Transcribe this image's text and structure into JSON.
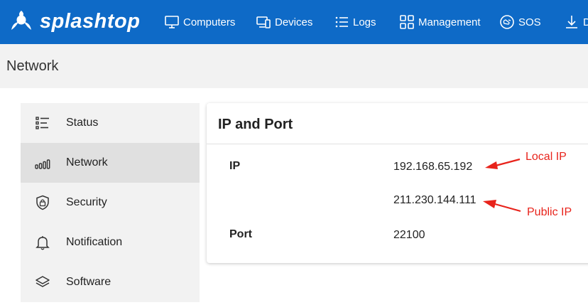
{
  "brand": {
    "logo_text": "splashtop"
  },
  "nav": {
    "items": [
      {
        "label": "Computers",
        "icon": "monitor-icon"
      },
      {
        "label": "Devices",
        "icon": "devices-icon"
      },
      {
        "label": "Logs",
        "icon": "list-icon"
      },
      {
        "label": "Management",
        "icon": "grid-icon"
      },
      {
        "label": "SOS",
        "icon": "sos-icon"
      },
      {
        "label": "D",
        "icon": "download-icon"
      }
    ]
  },
  "page": {
    "title": "Network"
  },
  "sidebar": {
    "items": [
      {
        "label": "Status",
        "icon": "status-list-icon",
        "active": false
      },
      {
        "label": "Network",
        "icon": "signal-bars-icon",
        "active": true
      },
      {
        "label": "Security",
        "icon": "shield-lock-icon",
        "active": false
      },
      {
        "label": "Notification",
        "icon": "bell-icon",
        "active": false
      },
      {
        "label": "Software",
        "icon": "layers-icon",
        "active": false
      }
    ]
  },
  "card": {
    "title": "IP and Port",
    "ip_label": "IP",
    "local_ip": "192.168.65.192",
    "public_ip": "211.230.144.111",
    "port_label": "Port",
    "port_value": "22100"
  },
  "annotations": {
    "local_ip_note": "Local IP",
    "public_ip_note": "Public IP",
    "color": "#e8231b"
  },
  "colors": {
    "topbar": "#0e6ac7",
    "subheader": "#f2f2f2",
    "sidebar_active": "#e0e0e0"
  }
}
